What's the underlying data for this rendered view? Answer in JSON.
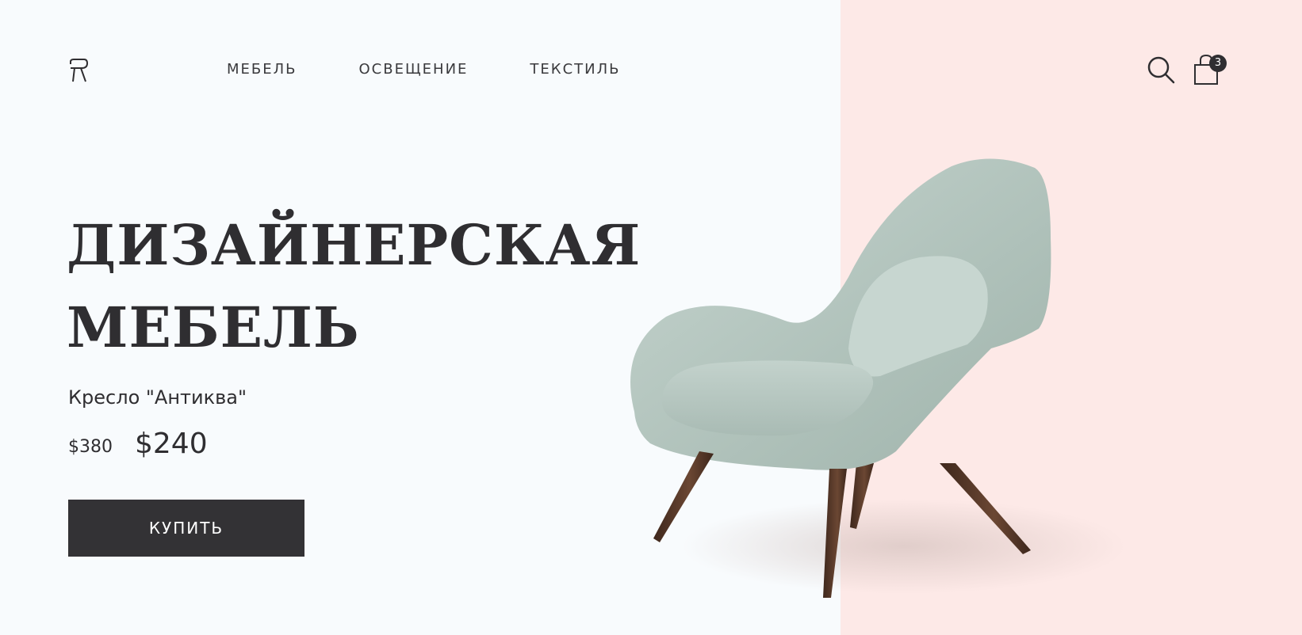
{
  "brand": {
    "logo_icon": "chair-logo-icon"
  },
  "nav": {
    "items": [
      {
        "label": "МЕБЕЛЬ"
      },
      {
        "label": "ОСВЕЩЕНИЕ"
      },
      {
        "label": "ТЕКСТИЛЬ"
      }
    ]
  },
  "header_actions": {
    "search_icon": "search-icon",
    "cart_icon": "shopping-bag-icon",
    "cart_count": "3"
  },
  "hero": {
    "title_line1": "ДИЗАЙНЕРСКАЯ",
    "title_line2": "МЕБЕЛЬ",
    "product_name": "Кресло \"Антиква\"",
    "price_old": "$380",
    "price_new": "$240",
    "buy_label": "КУПИТЬ",
    "image_icon": "armchair-image"
  },
  "colors": {
    "background_left": "#f8fbfd",
    "background_right": "#fde9e7",
    "text": "#2f2e31",
    "button": "#333235",
    "chair_fabric": "#b7c8c1",
    "chair_legs": "#5a3a2a"
  }
}
